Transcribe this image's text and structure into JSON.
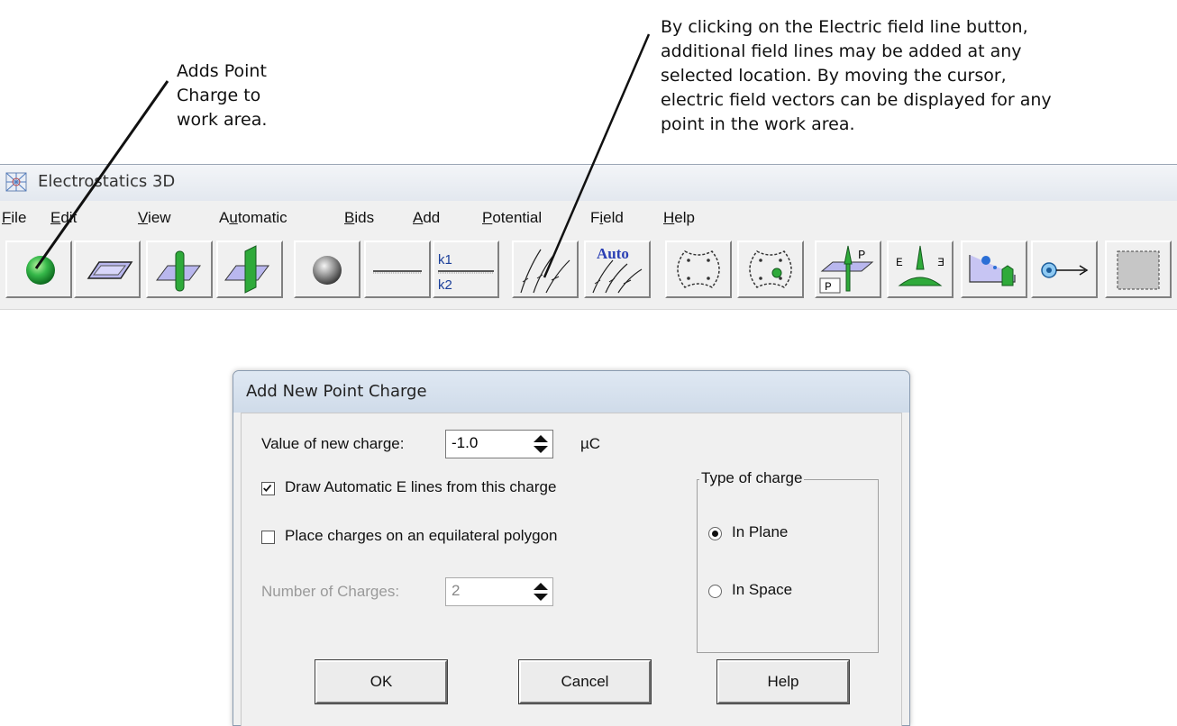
{
  "annotations": {
    "left_lines": [
      "Adds Point",
      "Charge to",
      "work area."
    ],
    "right_lines": [
      "By clicking on the Electric field line button,",
      "additional field lines may be added at any",
      "selected location.  By moving the cursor,",
      "electric field vectors can be displayed for any",
      "point in the work area."
    ]
  },
  "window": {
    "title": "Electrostatics 3D"
  },
  "menu": [
    {
      "text": "File",
      "accel": "F",
      "rest": "ile"
    },
    {
      "text": "Edit",
      "accel": "E",
      "rest": "dit"
    },
    {
      "text": "View",
      "accel": "V",
      "rest": "iew"
    },
    {
      "text": "Automatic",
      "pre": "A",
      "accel": "u",
      "rest": "tomatic"
    },
    {
      "text": "Bids",
      "accel": "B",
      "rest": "ids"
    },
    {
      "text": "Add",
      "accel": "A",
      "rest": "dd"
    },
    {
      "text": "Potential",
      "accel": "P",
      "rest": "otential"
    },
    {
      "text": "Field",
      "pre": "F",
      "accel": "i",
      "rest": "eld"
    },
    {
      "text": "Help",
      "accel": "H",
      "rest": "elp"
    }
  ],
  "toolbar": {
    "k1": "k1",
    "k2": "k2",
    "auto": "Auto",
    "p_label": "P",
    "e_label": "E",
    "tools": [
      "point-charge-icon",
      "plane-icon",
      "line-charge-icon",
      "charged-plane-icon",
      "sphere-icon",
      "line-icon",
      "dielectric-k1-k2-icon",
      "field-lines-icon",
      "auto-field-lines-icon",
      "polygon-outline-icon",
      "polygon-charges-icon",
      "potential-plane-icon",
      "field-plane-icon",
      "particle-move-icon",
      "charge-arrow-icon",
      "selection-box-icon"
    ]
  },
  "dialog": {
    "title": "Add New Point Charge",
    "value_label": "Value of new charge:",
    "value": "-1.0",
    "unit": "µC",
    "draw_auto_label": "Draw Automatic E lines from this charge",
    "draw_auto_checked": true,
    "polygon_label": "Place charges on an equilateral polygon",
    "polygon_checked": false,
    "num_charges_label": "Number of Charges:",
    "num_charges": "2",
    "type_group": "Type of charge",
    "in_plane": "In Plane",
    "in_space": "In Space",
    "selected_type": "In Plane",
    "ok": "OK",
    "cancel": "Cancel",
    "help": "Help"
  }
}
